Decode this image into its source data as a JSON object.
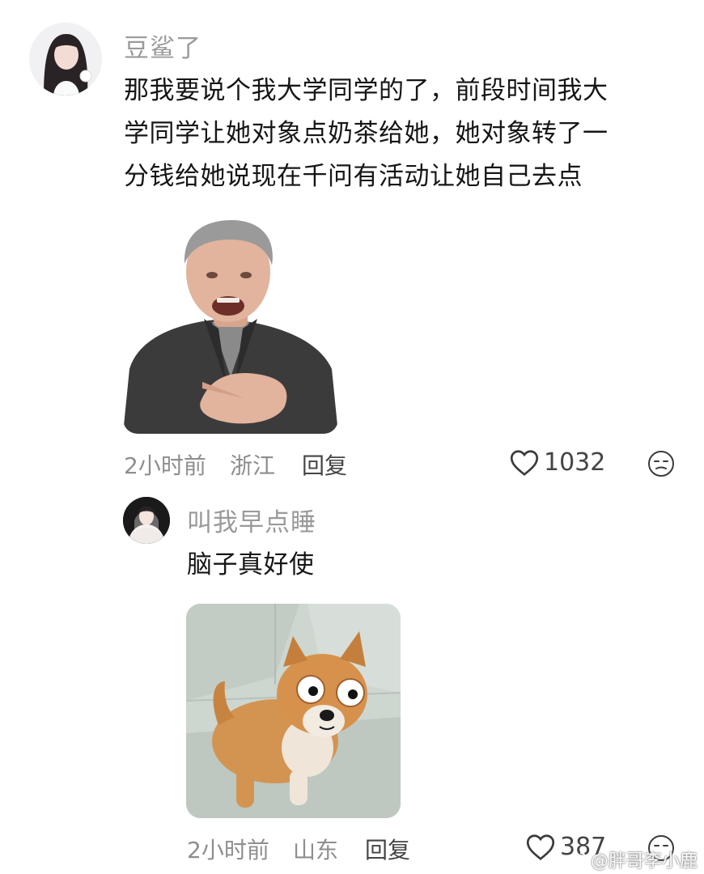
{
  "comment": {
    "username": "豆鲨了",
    "text_lines": [
      "那我要说个我大学同学的了，前段时间我大",
      "学同学让她对象点奶茶给她，她对象转了一",
      "分钱给她说现在千问有活动让她自己去点"
    ],
    "time": "2小时前",
    "location": "浙江",
    "reply_label": "回复",
    "like_count": "1032"
  },
  "reply": {
    "username": "叫我早点睡",
    "text": "脑子真好使",
    "time": "2小时前",
    "location": "山东",
    "reply_label": "回复",
    "like_count": "387"
  },
  "watermark": "@胖哥李小鹿",
  "icons": {
    "like": "heart-outline-icon",
    "reaction": "sleepy-face-icon"
  }
}
